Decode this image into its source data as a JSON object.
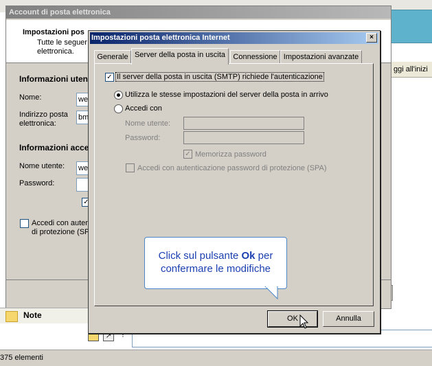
{
  "background": {
    "grid_header_text": "ggi all'inizi",
    "note_label": "Note",
    "status_text": "375 elementi"
  },
  "back_window": {
    "title": "Account di posta elettronica",
    "header_title": "Impostazioni pos",
    "header_line1": "Tutte le seguer",
    "header_line2": "elettronica.",
    "section_user": "Informazioni uten",
    "name_label": "Nome:",
    "name_value": "we",
    "email_label_1": "Indirizzo posta",
    "email_label_2": "elettronica:",
    "email_value": "bm",
    "section_access": "Informazioni acce",
    "username_label": "Nome utente:",
    "username_value": "we",
    "password_label": "Password:",
    "spa_label_1": "Accedi con auten",
    "spa_label_2": "di protezione (SP"
  },
  "dialog": {
    "title": "Impostazioni posta elettronica Internet",
    "close_glyph": "×",
    "tabs": [
      {
        "label": "Generale"
      },
      {
        "label": "Server della posta in uscita"
      },
      {
        "label": "Connessione"
      },
      {
        "label": "Impostazioni avanzate"
      }
    ],
    "smtp_auth_label": "Il server della posta in uscita (SMTP) richiede l'autenticazione",
    "smtp_auth_checked": true,
    "radio_same_label": "Utilizza le stesse impostazioni del server della posta in arrivo",
    "radio_login_label": "Accedi con",
    "username_label": "Nome utente:",
    "password_label": "Password:",
    "remember_label": "Memorizza password",
    "spa_label": "Accedi con autenticazione password di protezione (SPA)",
    "ok_label": "OK",
    "cancel_label": "Annulla"
  },
  "callout": {
    "text_before": "Click sul pulsante ",
    "text_bold": "Ok",
    "text_after": " per",
    "line2": "confermare le modifiche"
  },
  "colors": {
    "title_active": "#0a246a",
    "callout_text": "#1a3fb0",
    "callout_border": "#4a86c8",
    "accent_cyan": "#5fb2cc"
  }
}
